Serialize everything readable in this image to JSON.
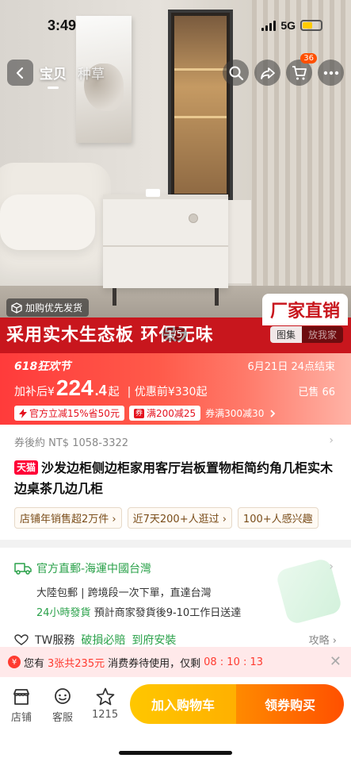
{
  "status_bar": {
    "time": "3:49",
    "network": "5G"
  },
  "nav": {
    "tabs": [
      {
        "label": "宝贝"
      },
      {
        "label": "种草"
      }
    ],
    "cart_count": "36"
  },
  "hero": {
    "priority_tag": "加购优先发货",
    "banner_text": "采用实木生态板 环保无味",
    "factory_badge": "厂家直销",
    "page_indicator": "1/5",
    "gallery_tabs": [
      "图集",
      "放我家"
    ]
  },
  "promo": {
    "event": "618狂欢节",
    "end_time": "6月21日 24点结束",
    "price_prefix": "加补后¥",
    "price_main": "224",
    "price_decimal": ".4",
    "price_suffix": "起",
    "original": "| 优惠前¥330起",
    "sold": "已售 66",
    "coupons": [
      {
        "label": "官方立减15%省50元"
      },
      {
        "label": "满200减25"
      }
    ],
    "coupon_tail": "券满300减30"
  },
  "product": {
    "estimate": "券後約 NT$ 1058-3322",
    "store_tag": "天猫",
    "title": "沙发边柜侧边柜家用客厅岩板置物柜简约角几柜实木边桌茶几边几柜",
    "chips": [
      "店铺年销售超2万件 ›",
      "近7天200+人逛过 ›",
      "100+人感兴趣"
    ]
  },
  "shipping": {
    "header": "官方直郵-海運中國台灣",
    "line1": "大陸包郵 | 跨境段一次下單，直達台灣",
    "line2_green": "24小時發貨",
    "line2": "預計商家發貨後9-10工作日送達",
    "tw_service": "TW服務",
    "tw_item1": "破損必賠",
    "tw_item2": "到府安裝",
    "tw_more": "攻略 ›"
  },
  "reminder": {
    "prefix": "您有",
    "count": "3张共235元",
    "middle": "消费券待使用，仅剩",
    "countdown": "08 : 10 : 13"
  },
  "bottom_bar": {
    "store": "店铺",
    "service": "客服",
    "fav_count": "1215",
    "add_cart": "加入购物车",
    "buy": "领券购买"
  },
  "colors": {
    "brand_orange": "#ff5000",
    "promo_red": "#ff3b3b",
    "green": "#2aa14a"
  }
}
